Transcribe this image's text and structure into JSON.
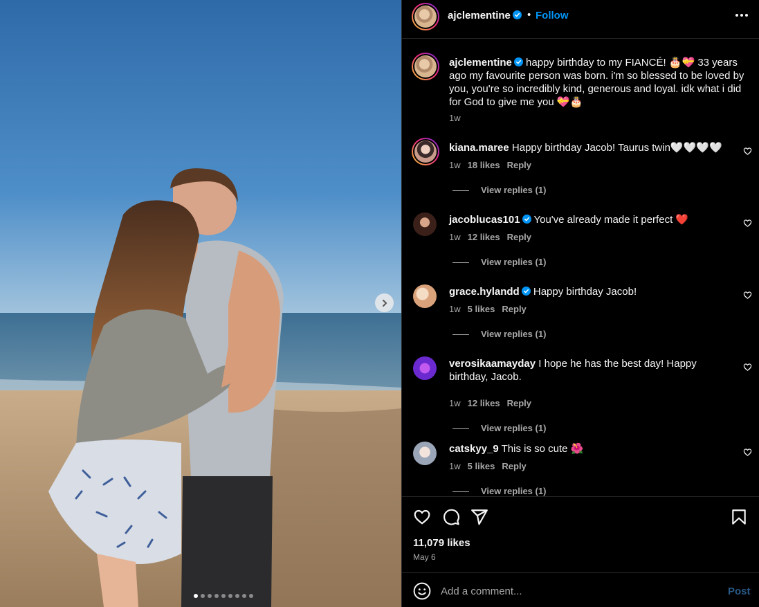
{
  "post": {
    "username": "ajclementine",
    "follow_label": "Follow",
    "separator": "•",
    "caption_text": "happy birthday to my FIANCÉ! 🎂💝 33 years ago my favourite person was born. i'm so blessed to be loved by you, you're so incredibly kind, generous and loyal. idk what i did for God to give me you 💝🎂",
    "caption_time": "1w",
    "reply_label": "Reply",
    "carousel_count": 9,
    "carousel_active": 0
  },
  "comments": [
    {
      "username": "kiana.maree",
      "text": "Happy birthday Jacob! Taurus twin🤍🤍🤍🤍",
      "time": "1w",
      "likes": "18 likes",
      "replies": "View replies (1)",
      "verified": false
    },
    {
      "username": "jacoblucas101",
      "text": "You've already made it perfect ❤️",
      "time": "1w",
      "likes": "12 likes",
      "replies": "View replies (1)",
      "verified": true
    },
    {
      "username": "grace.hylandd",
      "text": "Happy birthday Jacob!",
      "time": "1w",
      "likes": "5 likes",
      "replies": "View replies (1)",
      "verified": true
    },
    {
      "username": "verosikaamayday",
      "text": "I hope he has the best day! Happy birthday, Jacob.",
      "time": "1w",
      "likes": "12 likes",
      "replies": "View replies (1)",
      "verified": false
    },
    {
      "username": "catskyy_9",
      "text": "This is so cute 🌺",
      "time": "1w",
      "likes": "5 likes",
      "replies": "View replies (1)",
      "verified": false
    }
  ],
  "footer": {
    "likes": "11,079 likes",
    "date": "May 6",
    "comment_placeholder": "Add a comment...",
    "post_label": "Post"
  },
  "colors": {
    "accent": "#0095f6",
    "verified": "#0095f6",
    "muted": "#a8a8a8",
    "post_disabled": "#2a5885"
  }
}
